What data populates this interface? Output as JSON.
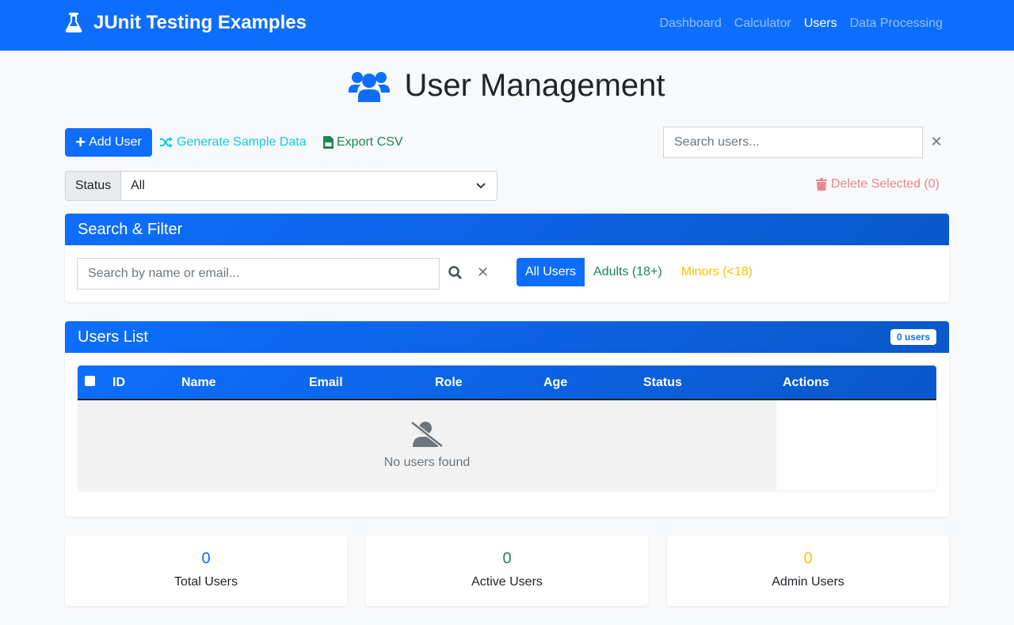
{
  "navbar": {
    "brand": "JUnit Testing Examples",
    "links": [
      "Dashboard",
      "Calculator",
      "Users",
      "Data Processing"
    ],
    "active": "Users"
  },
  "page": {
    "title": "User Management"
  },
  "toolbar": {
    "add_user": "Add User",
    "generate": "Generate Sample Data",
    "export_csv": "Export CSV",
    "search_placeholder": "Search users...",
    "status_label": "Status",
    "status_value": "All",
    "delete_selected": "Delete Selected (0)"
  },
  "filter": {
    "header": "Search & Filter",
    "search_placeholder": "Search by name or email...",
    "buttons": [
      "All Users",
      "Adults (18+)",
      "Minors (<18)"
    ]
  },
  "users_list": {
    "header": "Users List",
    "count_badge": "0 users",
    "columns": [
      "ID",
      "Name",
      "Email",
      "Role",
      "Age",
      "Status",
      "Actions"
    ],
    "empty_text": "No users found"
  },
  "stats": [
    {
      "value": "0",
      "label": "Total Users",
      "color": "#0d6efd"
    },
    {
      "value": "0",
      "label": "Active Users",
      "color": "#198754"
    },
    {
      "value": "0",
      "label": "Admin Users",
      "color": "#ffc107"
    }
  ],
  "colors": {
    "primary": "#0d6efd",
    "success": "#198754",
    "info": "#0dcaf0",
    "warning": "#ffc107",
    "danger_light": "#ea868f"
  }
}
